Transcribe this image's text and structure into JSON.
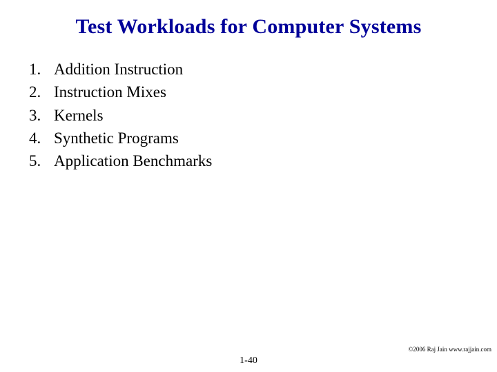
{
  "title": "Test Workloads for Computer Systems",
  "items": [
    {
      "num": "1.",
      "text": "Addition Instruction"
    },
    {
      "num": "2.",
      "text": "Instruction Mixes"
    },
    {
      "num": "3.",
      "text": "Kernels"
    },
    {
      "num": "4.",
      "text": "Synthetic Programs"
    },
    {
      "num": "5.",
      "text": "Application Benchmarks"
    }
  ],
  "copyright": "©2006 Raj Jain www.rajjain.com",
  "page_number": "1-40"
}
